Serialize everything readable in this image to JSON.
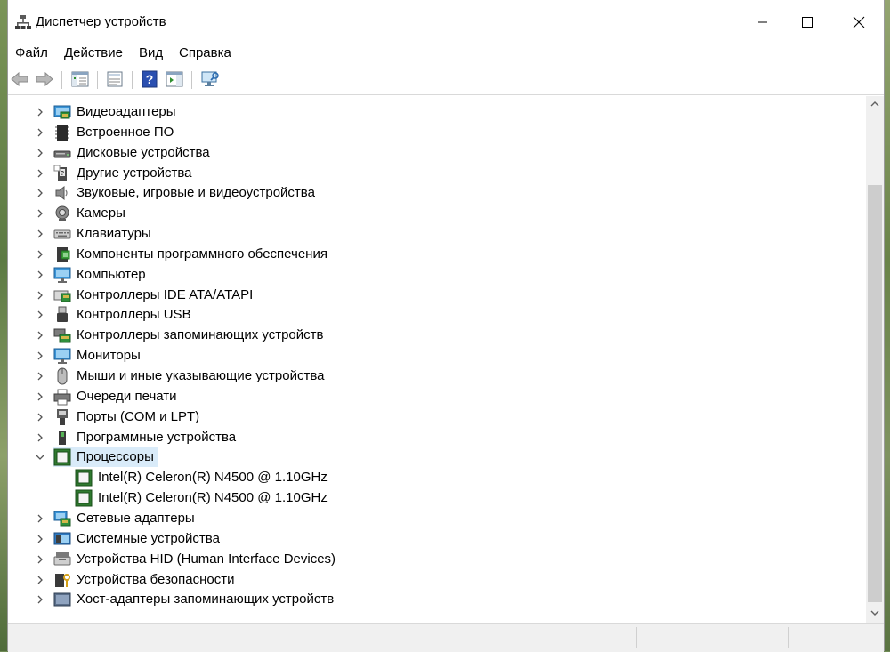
{
  "window": {
    "title": "Диспетчер устройств"
  },
  "menu": [
    "Файл",
    "Действие",
    "Вид",
    "Справка"
  ],
  "toolbar": {
    "buttons": [
      {
        "icon": "back-arrow-icon",
        "enabled": false
      },
      {
        "icon": "forward-arrow-icon",
        "enabled": false
      },
      {
        "icon": "show-hide-console-tree-icon"
      },
      {
        "icon": "properties-icon"
      },
      {
        "icon": "help-icon"
      },
      {
        "icon": "action-pane-icon"
      },
      {
        "icon": "scan-hardware-changes-icon"
      }
    ]
  },
  "tree": {
    "categories": [
      {
        "label": "Видеоадаптеры",
        "icon": "display-adapter-icon",
        "expanded": false
      },
      {
        "label": "Встроенное ПО",
        "icon": "firmware-icon",
        "expanded": false
      },
      {
        "label": "Дисковые устройства",
        "icon": "disk-drive-icon",
        "expanded": false
      },
      {
        "label": "Другие устройства",
        "icon": "other-devices-icon",
        "expanded": false
      },
      {
        "label": "Звуковые, игровые и видеоустройства",
        "icon": "speaker-icon",
        "expanded": false
      },
      {
        "label": "Камеры",
        "icon": "camera-icon",
        "expanded": false
      },
      {
        "label": "Клавиатуры",
        "icon": "keyboard-icon",
        "expanded": false
      },
      {
        "label": "Компоненты программного обеспечения",
        "icon": "software-component-icon",
        "expanded": false
      },
      {
        "label": "Компьютер",
        "icon": "computer-icon",
        "expanded": false
      },
      {
        "label": "Контроллеры IDE ATA/ATAPI",
        "icon": "ide-controller-icon",
        "expanded": false
      },
      {
        "label": "Контроллеры USB",
        "icon": "usb-icon",
        "expanded": false
      },
      {
        "label": "Контроллеры запоминающих устройств",
        "icon": "storage-controller-icon",
        "expanded": false
      },
      {
        "label": "Мониторы",
        "icon": "monitor-icon",
        "expanded": false
      },
      {
        "label": "Мыши и иные указывающие устройства",
        "icon": "mouse-icon",
        "expanded": false
      },
      {
        "label": "Очереди печати",
        "icon": "printer-icon",
        "expanded": false
      },
      {
        "label": "Порты (COM и LPT)",
        "icon": "port-icon",
        "expanded": false
      },
      {
        "label": "Программные устройства",
        "icon": "software-device-icon",
        "expanded": false
      },
      {
        "label": "Процессоры",
        "icon": "processor-icon",
        "expanded": true,
        "selected": true,
        "children": [
          "Intel(R) Celeron(R) N4500 @ 1.10GHz",
          "Intel(R) Celeron(R) N4500 @ 1.10GHz"
        ]
      },
      {
        "label": "Сетевые адаптеры",
        "icon": "network-adapter-icon",
        "expanded": false
      },
      {
        "label": "Системные устройства",
        "icon": "system-devices-icon",
        "expanded": false
      },
      {
        "label": "Устройства HID (Human Interface Devices)",
        "icon": "hid-icon",
        "expanded": false
      },
      {
        "label": "Устройства безопасности",
        "icon": "security-device-icon",
        "expanded": false
      },
      {
        "label": "Хост-адаптеры запоминающих устройств",
        "icon": "storage-host-adapter-icon",
        "expanded": false
      }
    ]
  },
  "colors": {
    "selection": "#d9ebf9",
    "chevron": "#555555",
    "scroll_thumb": "#cdcdcd"
  }
}
